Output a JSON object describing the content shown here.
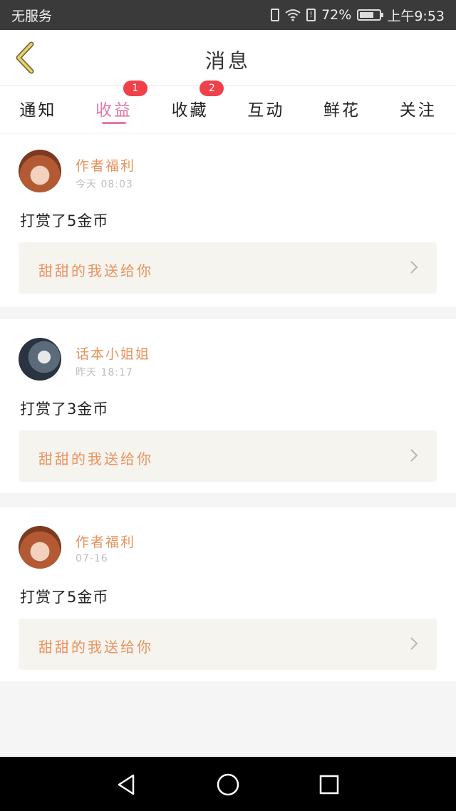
{
  "status_bar": {
    "carrier": "无服务",
    "battery_percent_label": "72%",
    "battery_level": 0.72,
    "time": "上午9:53",
    "icons": [
      "vibrate-icon",
      "wifi-icon",
      "alert-icon",
      "battery-icon"
    ]
  },
  "header": {
    "title": "消息",
    "back_icon": "chevron-left-icon"
  },
  "tabs": [
    {
      "label": "通知",
      "badge": ""
    },
    {
      "label": "收益",
      "badge": "1",
      "active": true
    },
    {
      "label": "收藏",
      "badge": "2"
    },
    {
      "label": "互动",
      "badge": ""
    },
    {
      "label": "鲜花",
      "badge": ""
    },
    {
      "label": "关注",
      "badge": ""
    }
  ],
  "messages": [
    {
      "name": "作者福利",
      "time": "今天 08:03",
      "reward": "打赏了5金币",
      "note": "甜甜的我送给你"
    },
    {
      "name": "话本小姐姐",
      "time": "昨天 18:17",
      "reward": "打赏了3金币",
      "note": "甜甜的我送给你"
    },
    {
      "name": "作者福利",
      "time": "07-16",
      "reward": "打赏了5金币",
      "note": "甜甜的我送给你"
    }
  ],
  "colors": {
    "accent_pink": "#e777a7",
    "name_orange": "#e9935e",
    "badge_red": "#f0404a"
  },
  "nav": {
    "icons": [
      "back-triangle-icon",
      "home-circle-icon",
      "recents-square-icon"
    ]
  }
}
